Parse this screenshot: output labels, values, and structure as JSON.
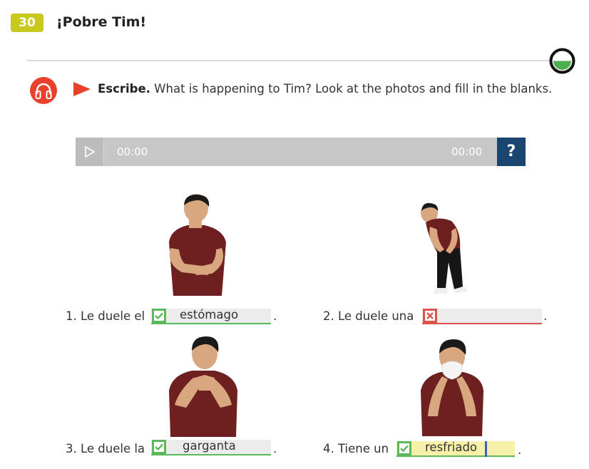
{
  "header": {
    "number": "30",
    "title": "¡Pobre Tim!"
  },
  "instruction": {
    "bold": "Escribe.",
    "text": " What is happening to Tim? Look at the photos and fill in the blanks."
  },
  "player": {
    "current_time": "00:00",
    "total_time": "00:00",
    "help_label": "?"
  },
  "items": [
    {
      "prompt": "1. Le duele el",
      "answer": "estómago",
      "status": "correct"
    },
    {
      "prompt": "2. Le duele una",
      "answer": "",
      "status": "incorrect"
    },
    {
      "prompt": "3. Le duele la",
      "answer": "garganta",
      "status": "correct"
    },
    {
      "prompt": "4. Tiene un",
      "answer": "resfriado",
      "status": "correct"
    }
  ],
  "punctuation": ".",
  "colors": {
    "badge": "#c8c81e",
    "correct": "#5cb85c",
    "incorrect": "#d9534f",
    "help": "#1a4570",
    "audio": "#e8402a",
    "progress": "#4cae4c",
    "shirt": "#6e1f1f"
  }
}
